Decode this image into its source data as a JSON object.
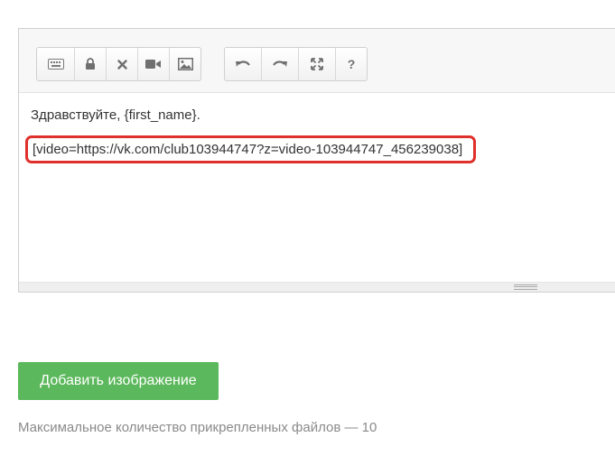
{
  "toolbar": {
    "group_left": [
      {
        "icon": "keyboard-icon"
      },
      {
        "icon": "lock-icon"
      },
      {
        "icon": "close-icon"
      },
      {
        "icon": "video-camera-icon"
      },
      {
        "icon": "image-icon"
      }
    ],
    "group_right": [
      {
        "icon": "undo-icon"
      },
      {
        "icon": "redo-icon"
      },
      {
        "icon": "fullscreen-icon"
      },
      {
        "icon": "help-icon",
        "label": "?"
      }
    ]
  },
  "editor": {
    "greeting": "Здравствуйте, {first_name}.",
    "video_tag": "[video=https://vk.com/club103944747?z=video-103944747_456239038]",
    "highlight_color": "#e0302b"
  },
  "actions": {
    "add_image_label": "Добавить изображение",
    "add_image_color": "#5cb85c"
  },
  "note": "Максимальное количество прикрепленных файлов — 10"
}
